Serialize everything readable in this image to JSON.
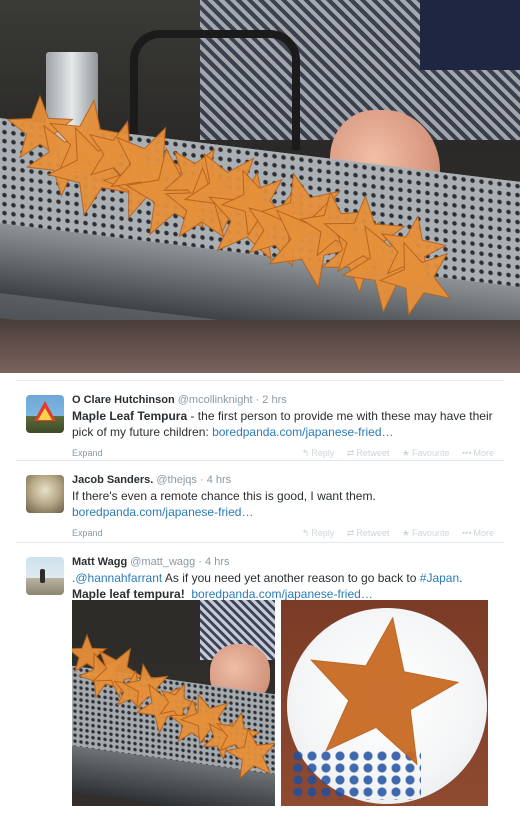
{
  "tweets": [
    {
      "name": "O Clare Hutchinson",
      "handle": "@mcollinknight",
      "separator": "·",
      "time": "2 hrs",
      "text_bold": "Maple Leaf Tempura",
      "text": " - the first person to provide me with these may have their pick of my future children: ",
      "link": "boredpanda.com/japanese-fried…",
      "expand": "Expand",
      "actions": {
        "reply": "Reply",
        "retweet": "Retweet",
        "favourite": "Favourite",
        "more": "More"
      }
    },
    {
      "name": "Jacob Sanders.",
      "handle": "@thejqs",
      "separator": "·",
      "time": "4 hrs",
      "text": "If there's even a remote chance this is good, I want them.",
      "link": "boredpanda.com/japanese-fried…",
      "expand": "Expand",
      "actions": {
        "reply": "Reply",
        "retweet": "Retweet",
        "favourite": "Favourite",
        "more": "More"
      }
    },
    {
      "name": "Matt Wagg",
      "handle": "@matt_wagg",
      "separator": "·",
      "time": "4 hrs",
      "mention": ".@hannahfarrant",
      "text": " As if you need yet another reason to go back to ",
      "hashtag": "#Japan",
      "text_end": ".",
      "text_bold": "Maple leaf tempura!",
      "link": "boredpanda.com/japanese-fried…"
    }
  ],
  "icons": {
    "reply": "reply-arrow-icon",
    "retweet": "retweet-icon",
    "favourite": "star-icon",
    "more": "ellipsis-icon"
  },
  "colors": {
    "link": "#2b7bb9",
    "muted": "#8899a6",
    "text": "#292f33",
    "tempura": "#e6903a"
  }
}
